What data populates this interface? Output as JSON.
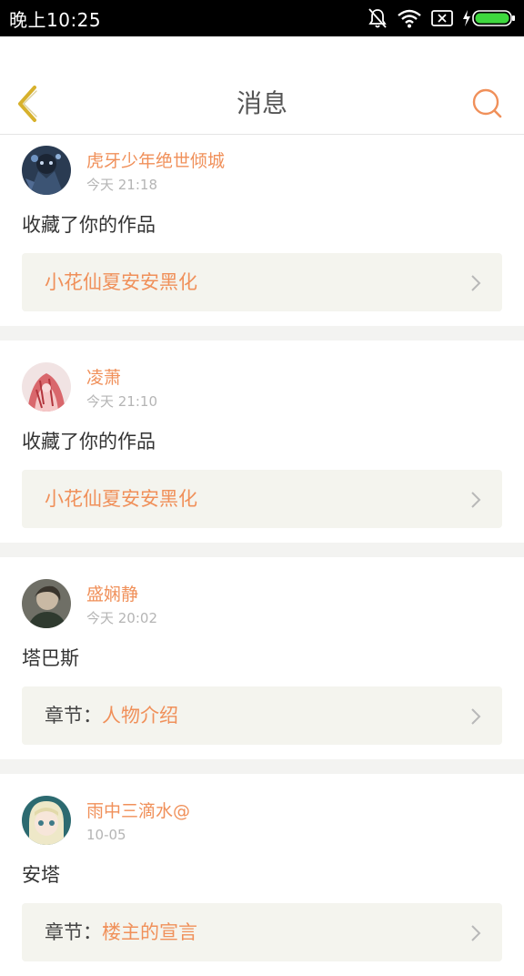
{
  "status_bar": {
    "time": "晚上10:25"
  },
  "header": {
    "title": "消息"
  },
  "messages": [
    {
      "user": "虎牙少年绝世倾城",
      "time": "今天 21:18",
      "action": "收藏了你的作品",
      "link_prefix": "",
      "link_target": "小花仙夏安安黑化"
    },
    {
      "user": "凌萧",
      "time": "今天 21:10",
      "action": "收藏了你的作品",
      "link_prefix": "",
      "link_target": "小花仙夏安安黑化"
    },
    {
      "user": "盛娴静",
      "time": "今天 20:02",
      "action": "塔巴斯",
      "link_prefix": "章节：",
      "link_target": "人物介绍"
    },
    {
      "user": "雨中三滴水@",
      "time": "10-05",
      "action": "安塔",
      "link_prefix": "章节：",
      "link_target": "楼主的宣言"
    }
  ],
  "colors": {
    "accent": "#f0905a",
    "back_arrow": "#d7b12c",
    "card_bg": "#f4f4ee"
  }
}
